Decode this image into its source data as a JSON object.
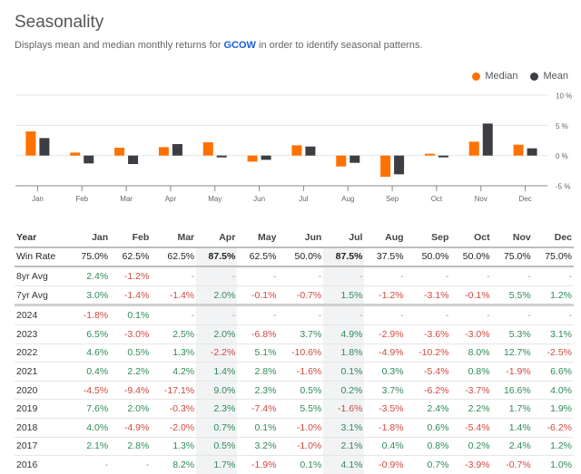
{
  "header": {
    "title": "Seasonality",
    "subtitle_prefix": "Displays mean and median monthly returns for ",
    "ticker": "GCOW",
    "subtitle_suffix": " in order to identify seasonal patterns."
  },
  "colors": {
    "median": "#ff7100",
    "mean": "#3d3d44",
    "positive": "#2e8b57",
    "negative": "#d0493f",
    "highlight_column": "#f2f3f5",
    "ticker_link": "#1a5fd6"
  },
  "chart_data": {
    "type": "bar",
    "title": "",
    "xlabel": "",
    "ylabel": "",
    "categories": [
      "Jan",
      "Feb",
      "Mar",
      "Apr",
      "May",
      "Jun",
      "Jul",
      "Aug",
      "Sep",
      "Oct",
      "Nov",
      "Dec"
    ],
    "series": [
      {
        "name": "Median",
        "color": "#ff7100",
        "values": [
          4.0,
          0.5,
          1.3,
          1.4,
          2.2,
          -1.0,
          1.7,
          -1.8,
          -3.5,
          0.3,
          2.3,
          1.8
        ]
      },
      {
        "name": "Mean",
        "color": "#3d3d44",
        "values": [
          2.9,
          -1.3,
          -1.4,
          1.9,
          -0.3,
          -0.7,
          1.5,
          -1.2,
          -3.1,
          -0.3,
          5.3,
          1.2
        ]
      }
    ],
    "ylim": [
      -5,
      10
    ],
    "yticks": [
      10,
      5,
      0,
      -5
    ],
    "ytick_labels": [
      "10 %",
      "5 %",
      "0 %",
      "-5 %"
    ],
    "y_axis_side": "right",
    "grid": true,
    "legend": {
      "placement": "top-right",
      "entries": [
        "Median",
        "Mean"
      ]
    }
  },
  "table": {
    "columns": [
      "Year",
      "Jan",
      "Feb",
      "Mar",
      "Apr",
      "May",
      "Jun",
      "Jul",
      "Aug",
      "Sep",
      "Oct",
      "Nov",
      "Dec"
    ],
    "highlighted_columns": [
      "Apr",
      "Jul"
    ],
    "win_rate": {
      "label": "Win Rate",
      "values": [
        "75.0%",
        "62.5%",
        "62.5%",
        "87.5%",
        "62.5%",
        "50.0%",
        "87.5%",
        "37.5%",
        "50.0%",
        "50.0%",
        "75.0%",
        "75.0%"
      ]
    },
    "averages": [
      {
        "label": "8yr Avg",
        "values": [
          "2.4%",
          "-1.2%",
          "-",
          "-",
          "-",
          "-",
          "-",
          "-",
          "-",
          "-",
          "-",
          "-"
        ]
      },
      {
        "label": "7yr Avg",
        "values": [
          "3.0%",
          "-1.4%",
          "-1.4%",
          "2.0%",
          "-0.1%",
          "-0.7%",
          "1.5%",
          "-1.2%",
          "-3.1%",
          "-0.1%",
          "5.5%",
          "1.2%"
        ]
      }
    ],
    "years": [
      {
        "label": "2024",
        "values": [
          "-1.8%",
          "0.1%",
          "-",
          "-",
          "-",
          "-",
          "-",
          "-",
          "-",
          "-",
          "-",
          "-"
        ]
      },
      {
        "label": "2023",
        "values": [
          "6.5%",
          "-3.0%",
          "2.5%",
          "2.0%",
          "-6.8%",
          "3.7%",
          "4.9%",
          "-2.9%",
          "-3.6%",
          "-3.0%",
          "5.3%",
          "3.1%"
        ]
      },
      {
        "label": "2022",
        "values": [
          "4.6%",
          "0.5%",
          "1.3%",
          "-2.2%",
          "5.1%",
          "-10.6%",
          "1.8%",
          "-4.9%",
          "-10.2%",
          "8.0%",
          "12.7%",
          "-2.5%"
        ]
      },
      {
        "label": "2021",
        "values": [
          "0.4%",
          "2.2%",
          "4.2%",
          "1.4%",
          "2.8%",
          "-1.6%",
          "0.1%",
          "0.3%",
          "-5.4%",
          "0.8%",
          "-1.9%",
          "6.6%"
        ]
      },
      {
        "label": "2020",
        "values": [
          "-4.5%",
          "-9.4%",
          "-17.1%",
          "9.0%",
          "2.3%",
          "0.5%",
          "0.2%",
          "3.7%",
          "-6.2%",
          "-3.7%",
          "16.6%",
          "4.0%"
        ]
      },
      {
        "label": "2019",
        "values": [
          "7.6%",
          "2.0%",
          "-0.3%",
          "2.3%",
          "-7.4%",
          "5.5%",
          "-1.6%",
          "-3.5%",
          "2.4%",
          "2.2%",
          "1.7%",
          "1.9%"
        ]
      },
      {
        "label": "2018",
        "values": [
          "4.0%",
          "-4.9%",
          "-2.0%",
          "0.7%",
          "0.1%",
          "-1.0%",
          "3.1%",
          "-1.8%",
          "0.6%",
          "-5.4%",
          "1.4%",
          "-6.2%"
        ]
      },
      {
        "label": "2017",
        "values": [
          "2.1%",
          "2.8%",
          "1.3%",
          "0.5%",
          "3.2%",
          "-1.0%",
          "2.1%",
          "0.4%",
          "0.8%",
          "0.2%",
          "2.4%",
          "1.2%"
        ]
      },
      {
        "label": "2016",
        "values": [
          "-",
          "-",
          "8.2%",
          "1.7%",
          "-1.9%",
          "0.1%",
          "4.1%",
          "-0.9%",
          "0.7%",
          "-3.9%",
          "-0.7%",
          "1.0%"
        ]
      }
    ]
  }
}
